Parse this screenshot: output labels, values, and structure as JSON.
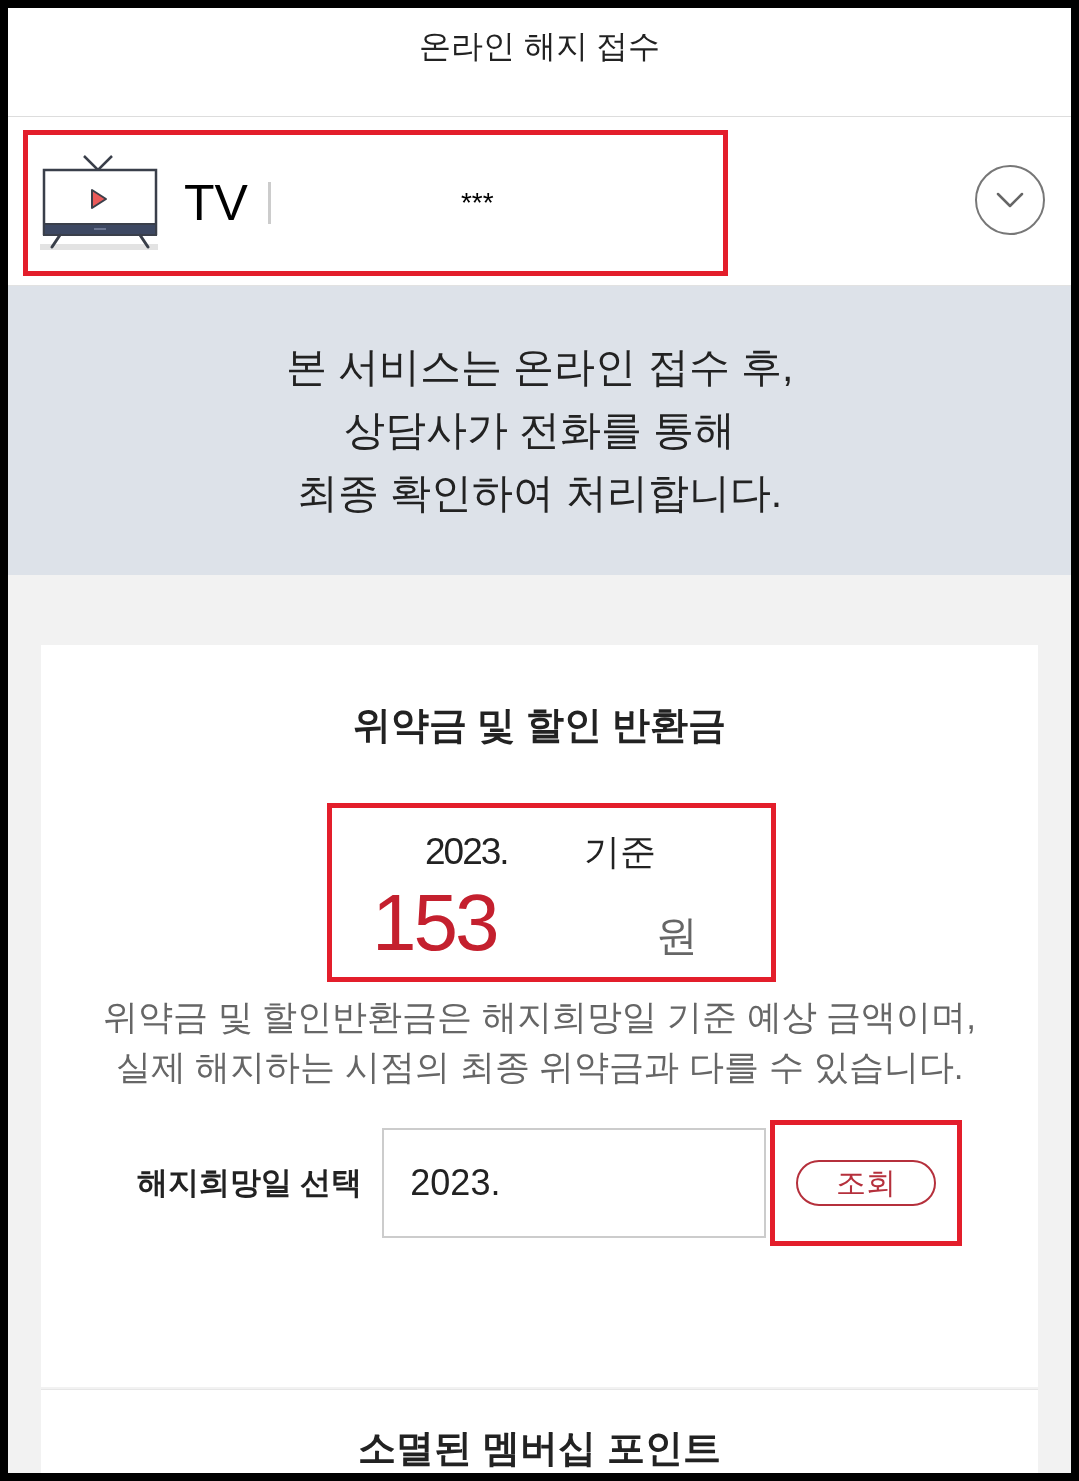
{
  "header": {
    "title": "온라인 해지 접수"
  },
  "service": {
    "name": "TV",
    "account": "***",
    "expanded": false,
    "highlighted": true
  },
  "notice": {
    "text": "본 서비스는 온라인 접수 후,\n상담사가 전화를 통해\n최종 확인하여 처리합니다."
  },
  "penalty_card": {
    "title": "위약금 및 할인 반환금",
    "estimate": {
      "date": "2023.",
      "date_suffix": "기준",
      "amount": "153",
      "unit": "원",
      "highlighted": true
    },
    "note": "위약금 및 할인반환금은 해지희망일 기준 예상 금액이며, 실제 해지하는 시점의 최종 위약금과 다를 수 있습니다.",
    "date_field": {
      "label": "해지희망일 선택",
      "value": "2023."
    },
    "lookup_button": {
      "label": "조회",
      "highlighted": true
    }
  },
  "next_section": {
    "title": "소멸된 멤버십 포인트"
  }
}
